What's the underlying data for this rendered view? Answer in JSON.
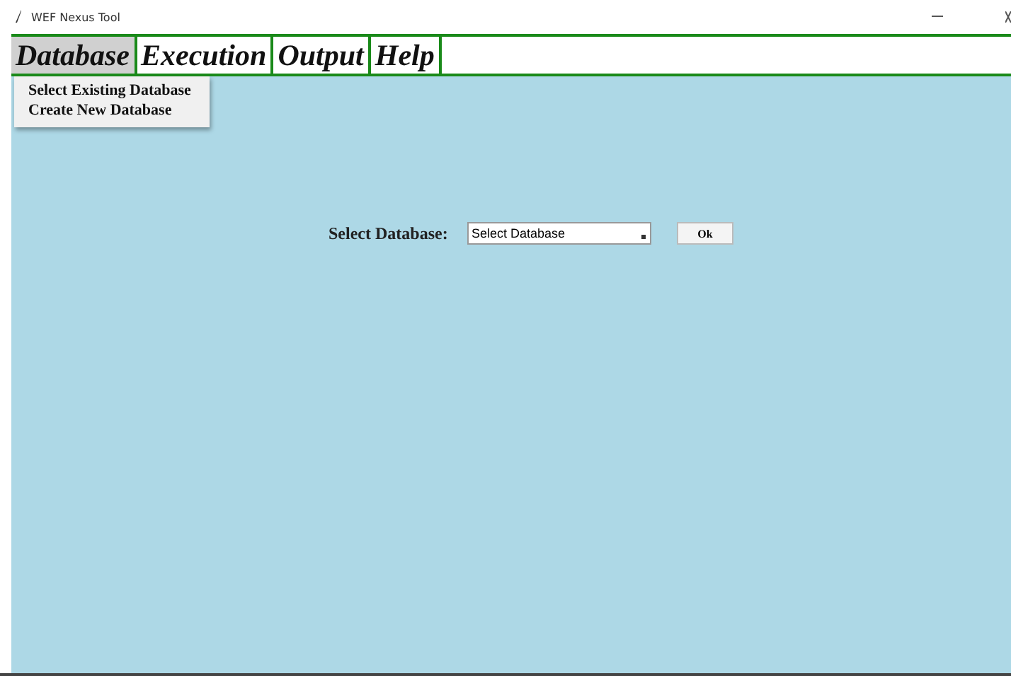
{
  "window": {
    "title": "WEF Nexus Tool"
  },
  "menu_bar": [
    {
      "label": "Database",
      "selected": true
    },
    {
      "label": "Execution",
      "selected": false
    },
    {
      "label": "Output",
      "selected": false
    },
    {
      "label": "Help",
      "selected": false
    }
  ],
  "open_menu": {
    "items": [
      "Select Existing Database",
      "Create New Database"
    ]
  },
  "form": {
    "label": "Select Database:",
    "select": {
      "value": "Select Database"
    },
    "button": "Ok"
  }
}
